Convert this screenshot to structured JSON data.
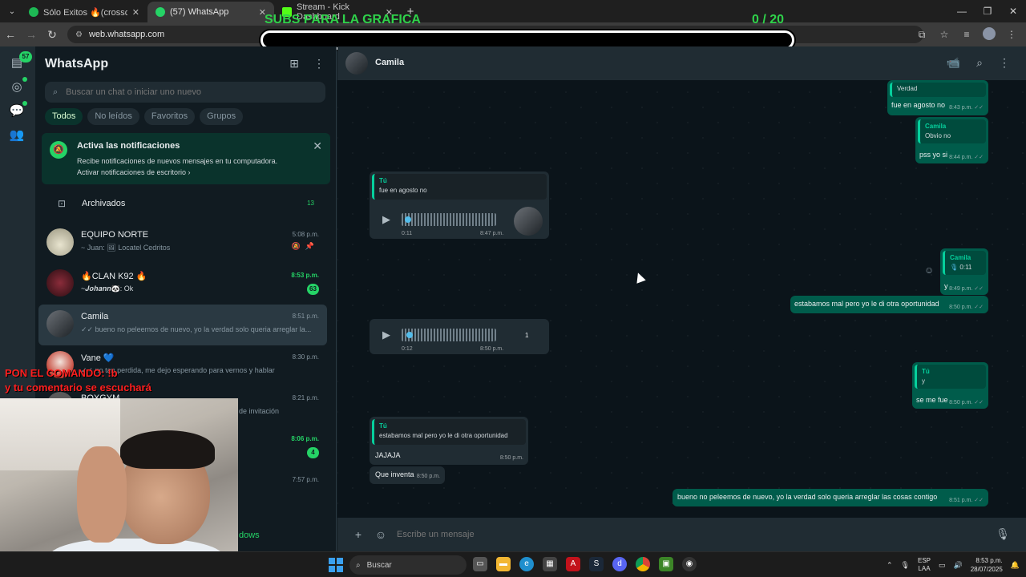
{
  "browser": {
    "tabs": [
      {
        "label": "Sólo Exitos 🔥(crossover)🔥 - ;",
        "icon": "spotify-icon",
        "color": "#1db954",
        "active": false
      },
      {
        "label": "(57) WhatsApp",
        "icon": "whatsapp-icon",
        "color": "#25d366",
        "active": true
      },
      {
        "label": "Stream - Kick Dashboard",
        "icon": "kick-icon",
        "color": "#53fc18",
        "active": false
      }
    ],
    "url": "web.whatsapp.com"
  },
  "overlay": {
    "goal_title": "SUBS PARA LA GRAFICA",
    "goal_count": "0 / 20",
    "goal_progress": 0,
    "cam_line1": "PON EL COMANDO: !b",
    "cam_line2": "y tu comentario se escuchará"
  },
  "rail": {
    "badge": "57"
  },
  "sidebar": {
    "title": "WhatsApp",
    "search_placeholder": "Buscar un chat o iniciar uno nuevo",
    "filters": [
      "Todos",
      "No leídos",
      "Favoritos",
      "Grupos"
    ],
    "notification": {
      "title": "Activa las notificaciones",
      "body": "Recibe notificaciones de nuevos mensajes en tu computadora.",
      "link": "Activar notificaciones de escritorio ›"
    },
    "archived": {
      "label": "Archivados",
      "count": "13"
    },
    "chats": [
      {
        "name": "EQUIPO NORTE",
        "time": "5:08 p.m.",
        "preview": "~ Juan: 🖼 Locatel Cedritos",
        "badge": "",
        "muted": true,
        "avatar": "#c7c4b0"
      },
      {
        "name": "🔥CLAN K92 🔥",
        "time": "8:53 p.m.",
        "preview": "~𝑱𝒐𝒉𝒂𝒏𝒏🐼: Ok",
        "badge": "63",
        "muted": false,
        "avatar": "#4a1d25"
      },
      {
        "name": "Camila",
        "time": "8:51 p.m.",
        "preview": "✓✓ bueno no peleemos de nuevo, yo la verdad solo queria arreglar la...",
        "badge": "",
        "muted": false,
        "avatar": "#3a3f44"
      },
      {
        "name": "Vane 💙",
        "time": "8:30 p.m.",
        "preview": "✓✓ no tan perdida, me dejo esperando para vernos y hablar",
        "badge": "",
        "muted": false,
        "avatar": "#e8d6d0"
      },
      {
        "name": "BOXGYM",
        "time": "8:21 p.m.",
        "preview": "de invitación",
        "badge": "",
        "muted": false,
        "avatar": "#5a5a5a"
      },
      {
        "name": "",
        "time": "8:06 p.m.",
        "preview": "",
        "badge": "4",
        "muted": false,
        "avatar": "#444"
      },
      {
        "name": "",
        "time": "7:57 p.m.",
        "preview": "",
        "badge": "",
        "muted": false,
        "avatar": "#444"
      }
    ],
    "footer": "dows"
  },
  "conversation": {
    "contact": "Camila",
    "messages": {
      "m1_quote_author": "Verdad",
      "m1_text": "fue en agosto no",
      "m1_time": "8:43 p.m.",
      "m2_quote_author": "Camila",
      "m2_quote_text": "Obvio no",
      "m2_text": "pss yo si",
      "m2_time": "8:44 p.m.",
      "m3_quote_author": "Tú",
      "m3_quote_text": "fue en agosto no",
      "m3_duration": "0:11",
      "m3_time": "8:47 p.m.",
      "m4_quote_author": "Camila",
      "m4_quote_text": "0:11",
      "m4_text": "y",
      "m4_time": "8:49 p.m.",
      "m5_text": "estabamos mal pero yo le di otra oportunidad",
      "m5_time": "8:50 p.m.",
      "m6_duration": "0:12",
      "m6_time": "8:50 p.m.",
      "m6_speed": "1",
      "m7_quote_author": "Tú",
      "m7_quote_text": "y",
      "m7_text": "se me fue",
      "m7_time": "8:50 p.m.",
      "m8_quote_author": "Tú",
      "m8_quote_text": "estabamos mal pero yo le di otra oportunidad",
      "m8_text": "JAJAJA",
      "m8_time": "8:50 p.m.",
      "m9_text": "Que inventa",
      "m9_time": "8:50 p.m.",
      "m10_text": "bueno no peleemos de nuevo, yo la verdad solo queria arreglar las cosas contigo",
      "m10_time": "8:51 p.m."
    },
    "composer_placeholder": "Escribe un mensaje"
  },
  "taskbar": {
    "search_label": "Buscar",
    "lang1": "ESP",
    "lang2": "LAA",
    "time": "8:53 p.m.",
    "date": "28/07/2025"
  }
}
